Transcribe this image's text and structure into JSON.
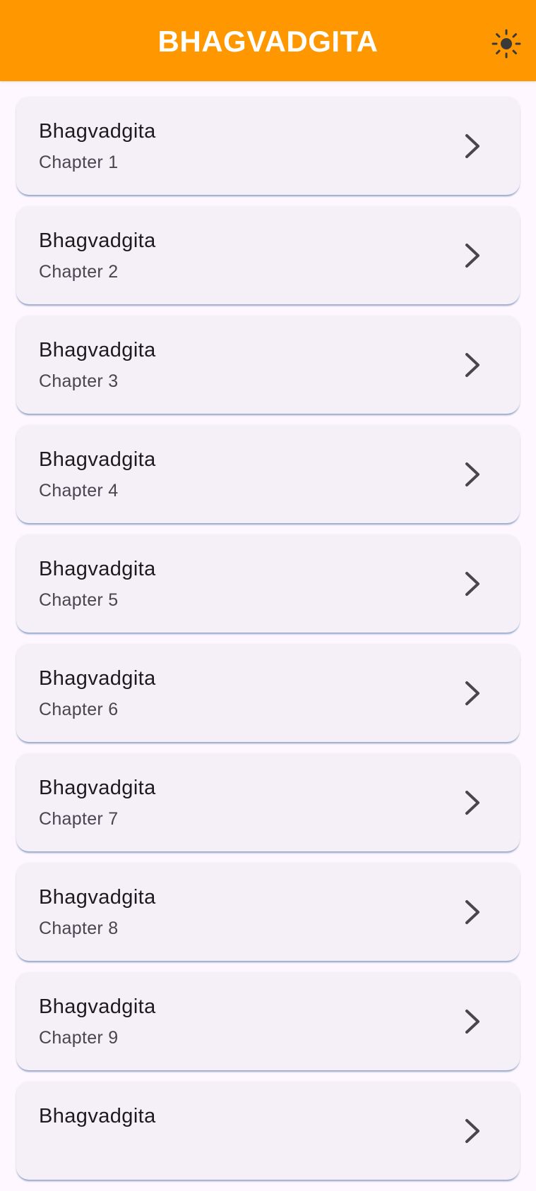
{
  "app_bar": {
    "title": "BHAGVADGITA",
    "background": "#FF9800",
    "theme_icon": "sun-icon"
  },
  "chapters": [
    {
      "title": "Bhagvadgita",
      "subtitle": "Chapter 1"
    },
    {
      "title": "Bhagvadgita",
      "subtitle": "Chapter 2"
    },
    {
      "title": "Bhagvadgita",
      "subtitle": "Chapter 3"
    },
    {
      "title": "Bhagvadgita",
      "subtitle": "Chapter 4"
    },
    {
      "title": "Bhagvadgita",
      "subtitle": "Chapter 5"
    },
    {
      "title": "Bhagvadgita",
      "subtitle": "Chapter 6"
    },
    {
      "title": "Bhagvadgita",
      "subtitle": "Chapter 7"
    },
    {
      "title": "Bhagvadgita",
      "subtitle": "Chapter 8"
    },
    {
      "title": "Bhagvadgita",
      "subtitle": "Chapter 9"
    },
    {
      "title": "Bhagvadgita",
      "subtitle": ""
    }
  ],
  "item_icon": "chevron-right-icon"
}
